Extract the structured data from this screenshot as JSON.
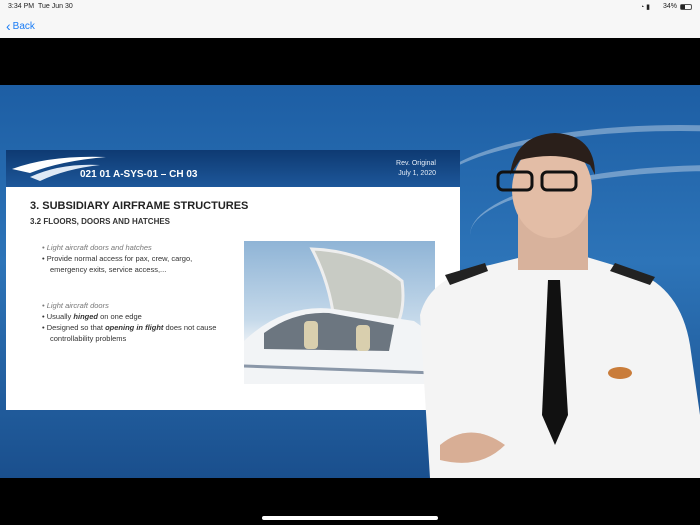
{
  "status_bar": {
    "time": "3:34 PM",
    "date": "Tue Jun 30",
    "battery": "34%"
  },
  "nav": {
    "back_label": "Back"
  },
  "slide": {
    "deck_code": "021 01 A-SYS-01 – CH 03",
    "revision": "Rev. Original",
    "rev_date": "July 1, 2020",
    "title": "3. SUBSIDIARY AIRFRAME STRUCTURES",
    "subtitle": "3.2 FLOORS, DOORS AND HATCHES",
    "group1": [
      "Light aircraft doors and hatches",
      "Provide normal access for pax, crew, cargo, emergency exits, service access,..."
    ],
    "group2": {
      "heading": "Light aircraft doors",
      "b1_pre": "Usually ",
      "b1_bold": "hinged",
      "b1_post": " on one edge",
      "b2_pre": "Designed so that ",
      "b2_bold": "opening in flight",
      "b2_post": " does not cause controllability problems"
    }
  }
}
